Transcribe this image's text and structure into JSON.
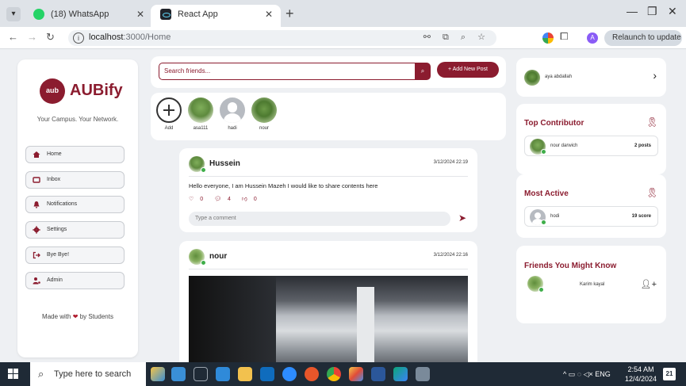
{
  "browser": {
    "tabs": [
      {
        "title": "(18) WhatsApp",
        "active": false
      },
      {
        "title": "React App",
        "active": true
      }
    ],
    "new_tab": "+",
    "tab_close": "✕",
    "window_controls": {
      "minimize": "—",
      "restore": "❐",
      "close": "✕"
    },
    "url_host": "localhost",
    "url_path": ":3000/Home",
    "relaunch_label": "Relaunch to update",
    "profile_initial": "A"
  },
  "sidebar": {
    "brand": "AUBify",
    "logo_text": "aub",
    "tagline": "Your Campus. Your Network.",
    "nav_items": [
      {
        "label": "Home",
        "icon": "home-icon"
      },
      {
        "label": "Inbox",
        "icon": "inbox-icon"
      },
      {
        "label": "Notifications",
        "icon": "bell-icon"
      },
      {
        "label": "Settings",
        "icon": "gear-icon"
      },
      {
        "label": "Bye Bye!",
        "icon": "logout-icon"
      },
      {
        "label": "Admin",
        "icon": "admin-icon"
      }
    ],
    "footer_prefix": "Made with",
    "footer_suffix": "by Students"
  },
  "search": {
    "placeholder": "Search friends...",
    "button_icon": "search-icon",
    "add_post_label": "+ Add New Post"
  },
  "friends": [
    {
      "name": "Add"
    },
    {
      "name": "asa111"
    },
    {
      "name": "hadi"
    },
    {
      "name": "nour"
    }
  ],
  "posts": [
    {
      "author": "Hussein",
      "date": "3/12/2024 22:19",
      "text": "Hello everyone, I am Hussein Mazeh I would like to share contents here",
      "likes": "0",
      "comments": "4",
      "dislikes": "0",
      "comment_placeholder": "Type a comment"
    },
    {
      "author": "nour",
      "date": "3/12/2024 22:16"
    }
  ],
  "right": {
    "profile_name": "aya abdallah",
    "top_contributor": {
      "title": "Top Contributor",
      "name": "nour darwich",
      "value": "2 posts"
    },
    "most_active": {
      "title": "Most Active",
      "name": "hodi",
      "value": "19 score"
    },
    "suggestions": {
      "title": "Friends You Might Know",
      "name": "Karim kayal"
    }
  },
  "taskbar": {
    "search_text": "Type here to search",
    "language": "ENG",
    "time": "2:54 AM",
    "date": "12/4/2024",
    "notifications": "21"
  },
  "colors": {
    "brand": "#8b1c2f",
    "online": "#3fae4a",
    "background": "#eef0f3"
  }
}
